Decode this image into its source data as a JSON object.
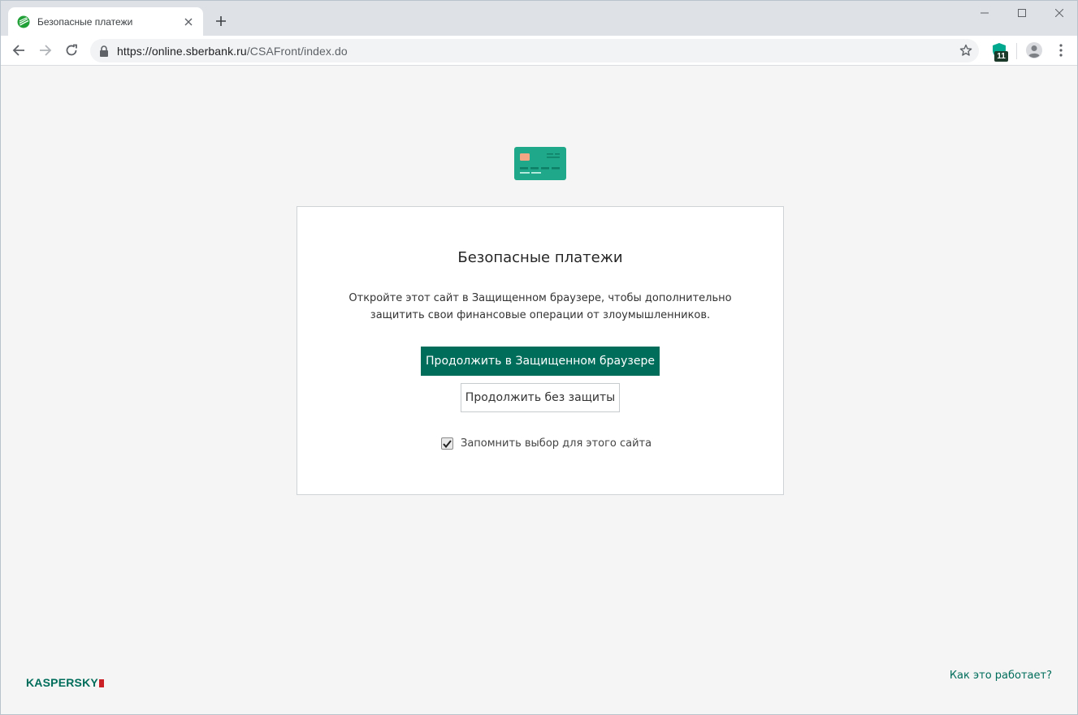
{
  "browser": {
    "tab_title": "Безопасные платежи",
    "url_host": "https://online.sberbank.ru",
    "url_path": "/CSAFront/index.do",
    "extension_badge": "11"
  },
  "page": {
    "title": "Безопасные платежи",
    "description": "Откройте этот сайт в Защищенном браузере, чтобы дополнительно защитить свои финансовые операции от злоумышленников.",
    "primary_button": "Продолжить в Защищенном браузере",
    "secondary_button": "Продолжить без защиты",
    "remember_label": "Запомнить выбор для этого сайта",
    "remember_checked": true,
    "brand": "KASPERSKY",
    "how_it_works": "Как это работает?"
  },
  "colors": {
    "accent": "#006d5b",
    "card": "#1fa98a",
    "background": "#f5f5f5"
  }
}
